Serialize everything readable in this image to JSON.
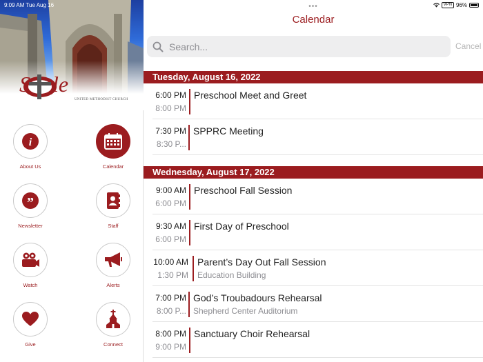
{
  "status": {
    "time_day": "9:09 AM  Tue Aug 16",
    "battery": "96%",
    "vpn": "VPN"
  },
  "sidebar": {
    "brand": "Settle",
    "brand_sub": "UNITED METHODIST CHURCH",
    "tiles": [
      {
        "label": "About Us",
        "icon": "info-icon"
      },
      {
        "label": "Calendar",
        "icon": "calendar-icon"
      },
      {
        "label": "Newsletter",
        "icon": "quote-icon"
      },
      {
        "label": "Staff",
        "icon": "contacts-book-icon"
      },
      {
        "label": "Watch",
        "icon": "video-camera-icon"
      },
      {
        "label": "Alerts",
        "icon": "megaphone-icon"
      },
      {
        "label": "Give",
        "icon": "heart-icon"
      },
      {
        "label": "Connect",
        "icon": "church-icon"
      }
    ]
  },
  "header": {
    "title": "Calendar",
    "dots": "•••"
  },
  "search": {
    "placeholder": "Search...",
    "cancel": "Cancel"
  },
  "days": [
    {
      "date": "Tuesday, August 16, 2022",
      "events": [
        {
          "start": "6:00 PM",
          "end": "8:00 PM",
          "title": "Preschool Meet and Greet",
          "location": ""
        },
        {
          "start": "7:30 PM",
          "end": "8:30 P...",
          "title": "SPPRC Meeting",
          "location": ""
        }
      ]
    },
    {
      "date": "Wednesday, August 17, 2022",
      "events": [
        {
          "start": "9:00 AM",
          "end": "6:00 PM",
          "title": "Preschool Fall Session",
          "location": ""
        },
        {
          "start": "9:30 AM",
          "end": "6:00 PM",
          "title": "First Day of Preschool",
          "location": ""
        },
        {
          "start": "10:00 AM",
          "end": "1:30 PM",
          "title": "Parent’s Day Out Fall Session",
          "location": "Education Building"
        },
        {
          "start": "7:00 PM",
          "end": "8:00 P...",
          "title": "God’s Troubadours Rehearsal",
          "location": "Shepherd Center Auditorium"
        },
        {
          "start": "8:00 PM",
          "end": "9:00 PM",
          "title": "Sanctuary Choir Rehearsal",
          "location": ""
        }
      ]
    }
  ],
  "colors": {
    "accent": "#9b1c1f",
    "search_bg": "#eeeeef"
  }
}
